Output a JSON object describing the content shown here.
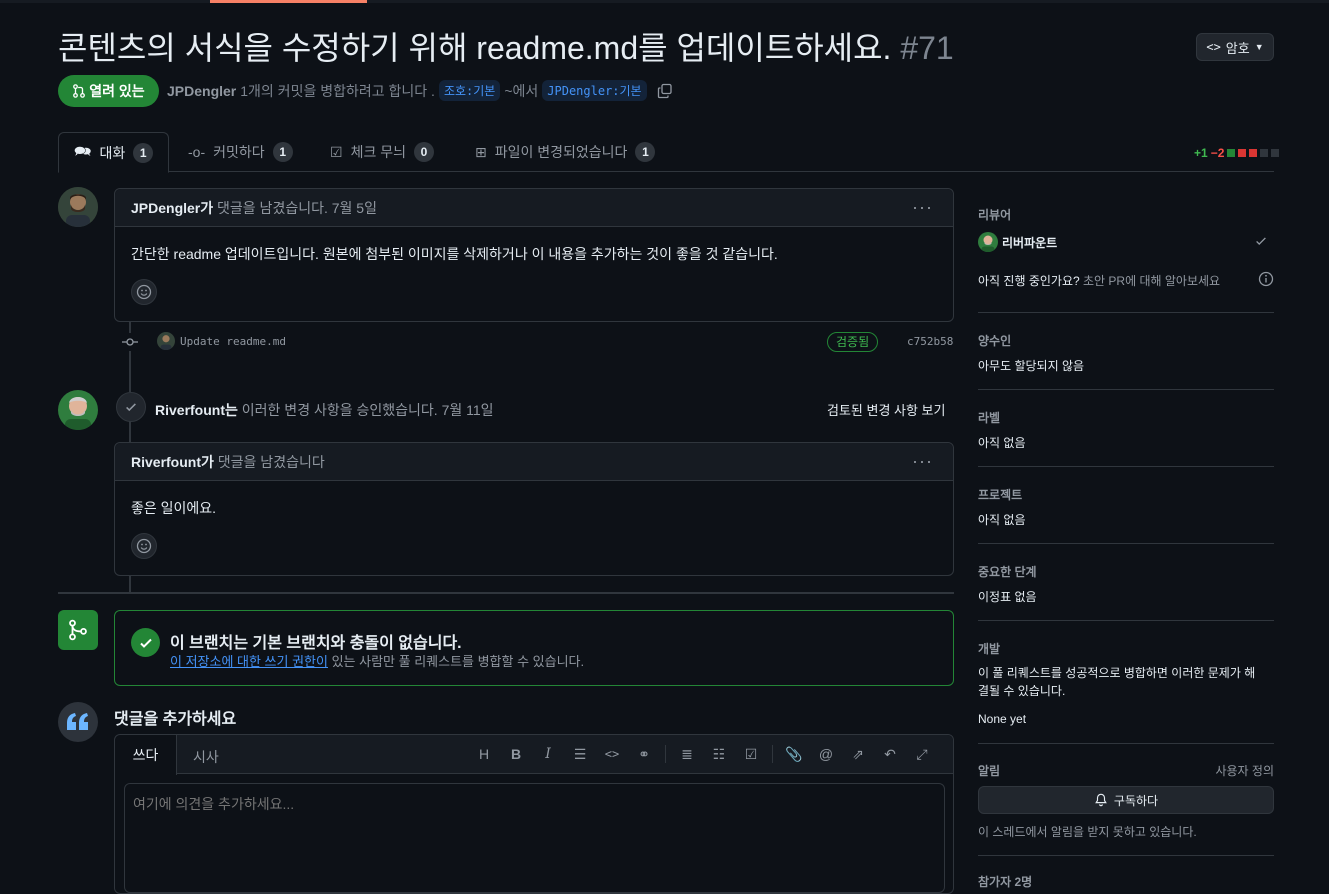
{
  "header": {
    "title": "콘텐츠의 서식을 수정하기 위해 readme.md를 업데이트하세요.",
    "number": "#71",
    "code_label": "암호",
    "state_label": "열려 있는",
    "author": "JPDengler",
    "merge_text": "1개의 커밋을 병합하려고 합니다 .",
    "base_branch": "조호:기본",
    "from_text": "~에서",
    "head_branch": "JPDengler:기본"
  },
  "tabs": [
    {
      "label": "대화",
      "count": "1"
    },
    {
      "label": "커밋하다",
      "count": "1"
    },
    {
      "label": "체크 무늬",
      "count": "0"
    },
    {
      "label": "파일이 변경되었습니다",
      "count": "1"
    }
  ],
  "diffstat": {
    "additions": "+1",
    "deletions": "−2"
  },
  "timeline": {
    "comment1": {
      "author": "JPDengler가",
      "action": "댓글을 남겼습니다.",
      "date": "7월 5일",
      "body": "간단한 readme 업데이트입니다. 원본에 첨부된 이미지를 삭제하거나 이 내용을 추가하는 것이 좋을 것 같습니다."
    },
    "commit": {
      "message": "Update readme.md",
      "verified": "검증됨",
      "sha": "c752b58"
    },
    "review": {
      "author": "Riverfount는",
      "action": "이러한 변경 사항을 승인했습니다.",
      "date": "7월 11일",
      "view_link": "검토된 변경 사항 보기"
    },
    "comment2": {
      "author": "Riverfount가",
      "action": "댓글을 남겼습니다",
      "body": "좋은 일이에요."
    }
  },
  "merge_box": {
    "title": "이 브랜치는 기본 브랜치와 충돌이 없습니다.",
    "link_text": "이 저장소에 대한 쓰기 권한이",
    "rest_text": "있는 사람만 풀 리퀘스트를 병합할 수 있습니다."
  },
  "add_comment": {
    "heading": "댓글을 추가하세요",
    "write_tab": "쓰다",
    "preview_tab": "시사",
    "placeholder": "여기에 의견을 추가하세요..."
  },
  "sidebar": {
    "reviewers_label": "리뷰어",
    "reviewer_name": "리버파운트",
    "still_in_progress": "아직 진행 중인가요?",
    "draft_learn": "초안 PR에 대해 알아보세요",
    "assignees_label": "양수인",
    "assignees_value": "아무도 할당되지 않음",
    "labels_label": "라벨",
    "labels_value": "아직 없음",
    "projects_label": "프로젝트",
    "projects_value": "아직 없음",
    "milestone_label": "중요한 단계",
    "milestone_value": "이정표 없음",
    "development_label": "개발",
    "development_text": "이 풀 리퀘스트를 성공적으로 병합하면 이러한 문제가 해결될 수 있습니다.",
    "development_none": "None yet",
    "notifications_label": "알림",
    "customize": "사용자 정의",
    "subscribe": "구독하다",
    "notif_status": "이 스레드에서 알림을 받지 못하고 있습니다.",
    "participants_label": "참가자 2명"
  },
  "colors": {
    "accent_green": "#238636",
    "link_blue": "#4493f8",
    "bg": "#0d1117",
    "border": "#30363d"
  }
}
